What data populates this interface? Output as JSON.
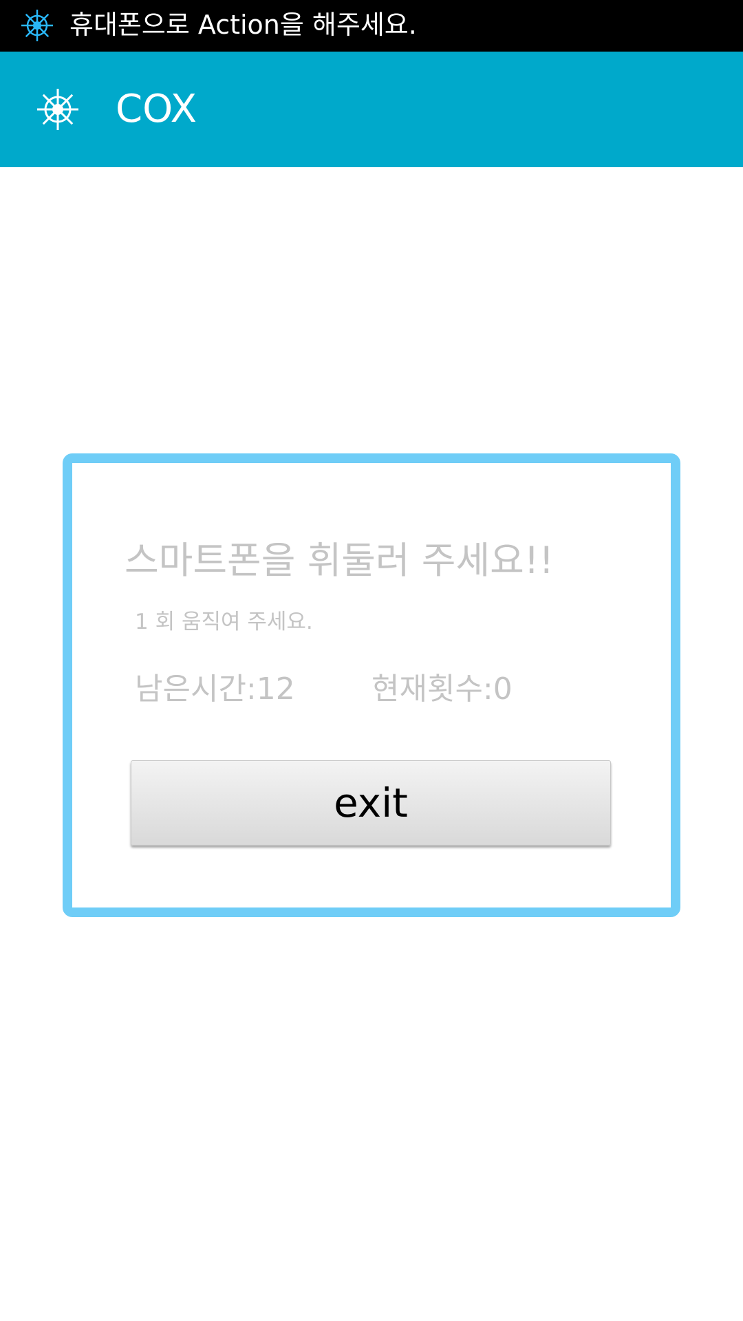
{
  "status_bar": {
    "notification_icon": "ship-wheel-icon",
    "text": "휴대폰으로 Action을 해주세요."
  },
  "action_bar": {
    "app_icon": "ship-wheel-icon",
    "title": "COX"
  },
  "dialog": {
    "title": "스마트폰을 휘둘러 주세요!!",
    "subtitle": "1 회 움직여 주세요.",
    "remaining_time": "남은시간:12",
    "current_count": "현재횟수:0",
    "exit_label": "exit"
  },
  "colors": {
    "status_bar": "#000000",
    "action_bar": "#00a9cb",
    "dialog_border": "#6fcdf7",
    "dialog_text": "#c4c4c4"
  }
}
